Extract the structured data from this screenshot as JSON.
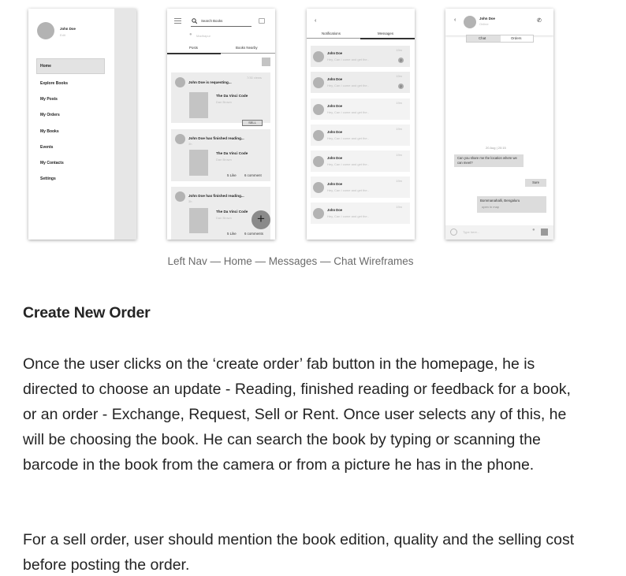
{
  "figure": {
    "caption": "Left Nav — Home — Messages — Chat Wireframes",
    "nav": {
      "user_name": "John Doe",
      "user_sub": "Edit",
      "items": [
        "Home",
        "Explore Books",
        "My Posts",
        "My Orders",
        "My Books",
        "Events",
        "My Contacts",
        "Settings"
      ]
    },
    "home": {
      "search_placeholder": "Search Books",
      "location": "Madhapur",
      "tabs": [
        "Posts",
        "Books Nearby"
      ],
      "posts": [
        {
          "author": "John Doe is requesting...",
          "meta": "15m",
          "time": "7/30 views",
          "book_title": "The Da Vinci Code",
          "book_author": "Dan Brown",
          "action": "SELL"
        },
        {
          "author": "John Doe has finished reading...",
          "meta": "3h",
          "book_title": "The Da Vinci Code",
          "book_author": "Dan Brown",
          "likes": "5 Like",
          "comments": "6 comment"
        },
        {
          "author": "John Doe has finished reading...",
          "meta": "3h",
          "book_title": "The Da Vinci Code",
          "book_author": "Dan Brown",
          "likes": "5 Like",
          "comments": "6 comments"
        }
      ],
      "fab_symbol": "+"
    },
    "messages": {
      "tabs": [
        "Notifications",
        "Messages"
      ],
      "items": [
        {
          "name": "John Doe",
          "preview": "Hey, Can I come and get the..",
          "time": "19m",
          "badge": "2"
        },
        {
          "name": "John Doe",
          "preview": "Hey, Can I come and get the..",
          "time": "19m",
          "badge": "2"
        },
        {
          "name": "John Doe",
          "preview": "Hey, Can I come and get the..",
          "time": "19m",
          "badge": ""
        },
        {
          "name": "John Doe",
          "preview": "Hey, Can I come and get the..",
          "time": "19m",
          "badge": ""
        },
        {
          "name": "John Doe",
          "preview": "Hey, Can I come and get the..",
          "time": "19m",
          "badge": ""
        },
        {
          "name": "John Doe",
          "preview": "Hey, Can I come and get the..",
          "time": "19m",
          "badge": ""
        },
        {
          "name": "John Doe",
          "preview": "Hey, Can I come and get the..",
          "time": "19m",
          "badge": ""
        }
      ]
    },
    "chat": {
      "name": "John Doe",
      "status": "Online",
      "tabs": [
        "Chat",
        "Orders"
      ],
      "date": "20 Aug | 20:15",
      "bubble_in": "Can you share me the location where we can meet?",
      "bubble_out": "Sure",
      "location_name": "Bommanahalli, Bengaluru",
      "location_sub": "open in map",
      "input_placeholder": "Type here..."
    }
  },
  "article": {
    "heading": "Create New Order",
    "paragraphs": [
      "Once the user clicks on the ‘create order’ fab button in the homepage, he is directed to choose an update - Reading, finished reading or feedback for a book, or an order - Exchange, Request, Sell or Rent. Once user selects any of this, he will be choosing the book. He can search the book by typing or scanning the barcode in the book from the camera or from a picture he has in the phone.",
      "For a sell order, user should mention the book edition, quality and the selling cost before posting the order."
    ]
  }
}
